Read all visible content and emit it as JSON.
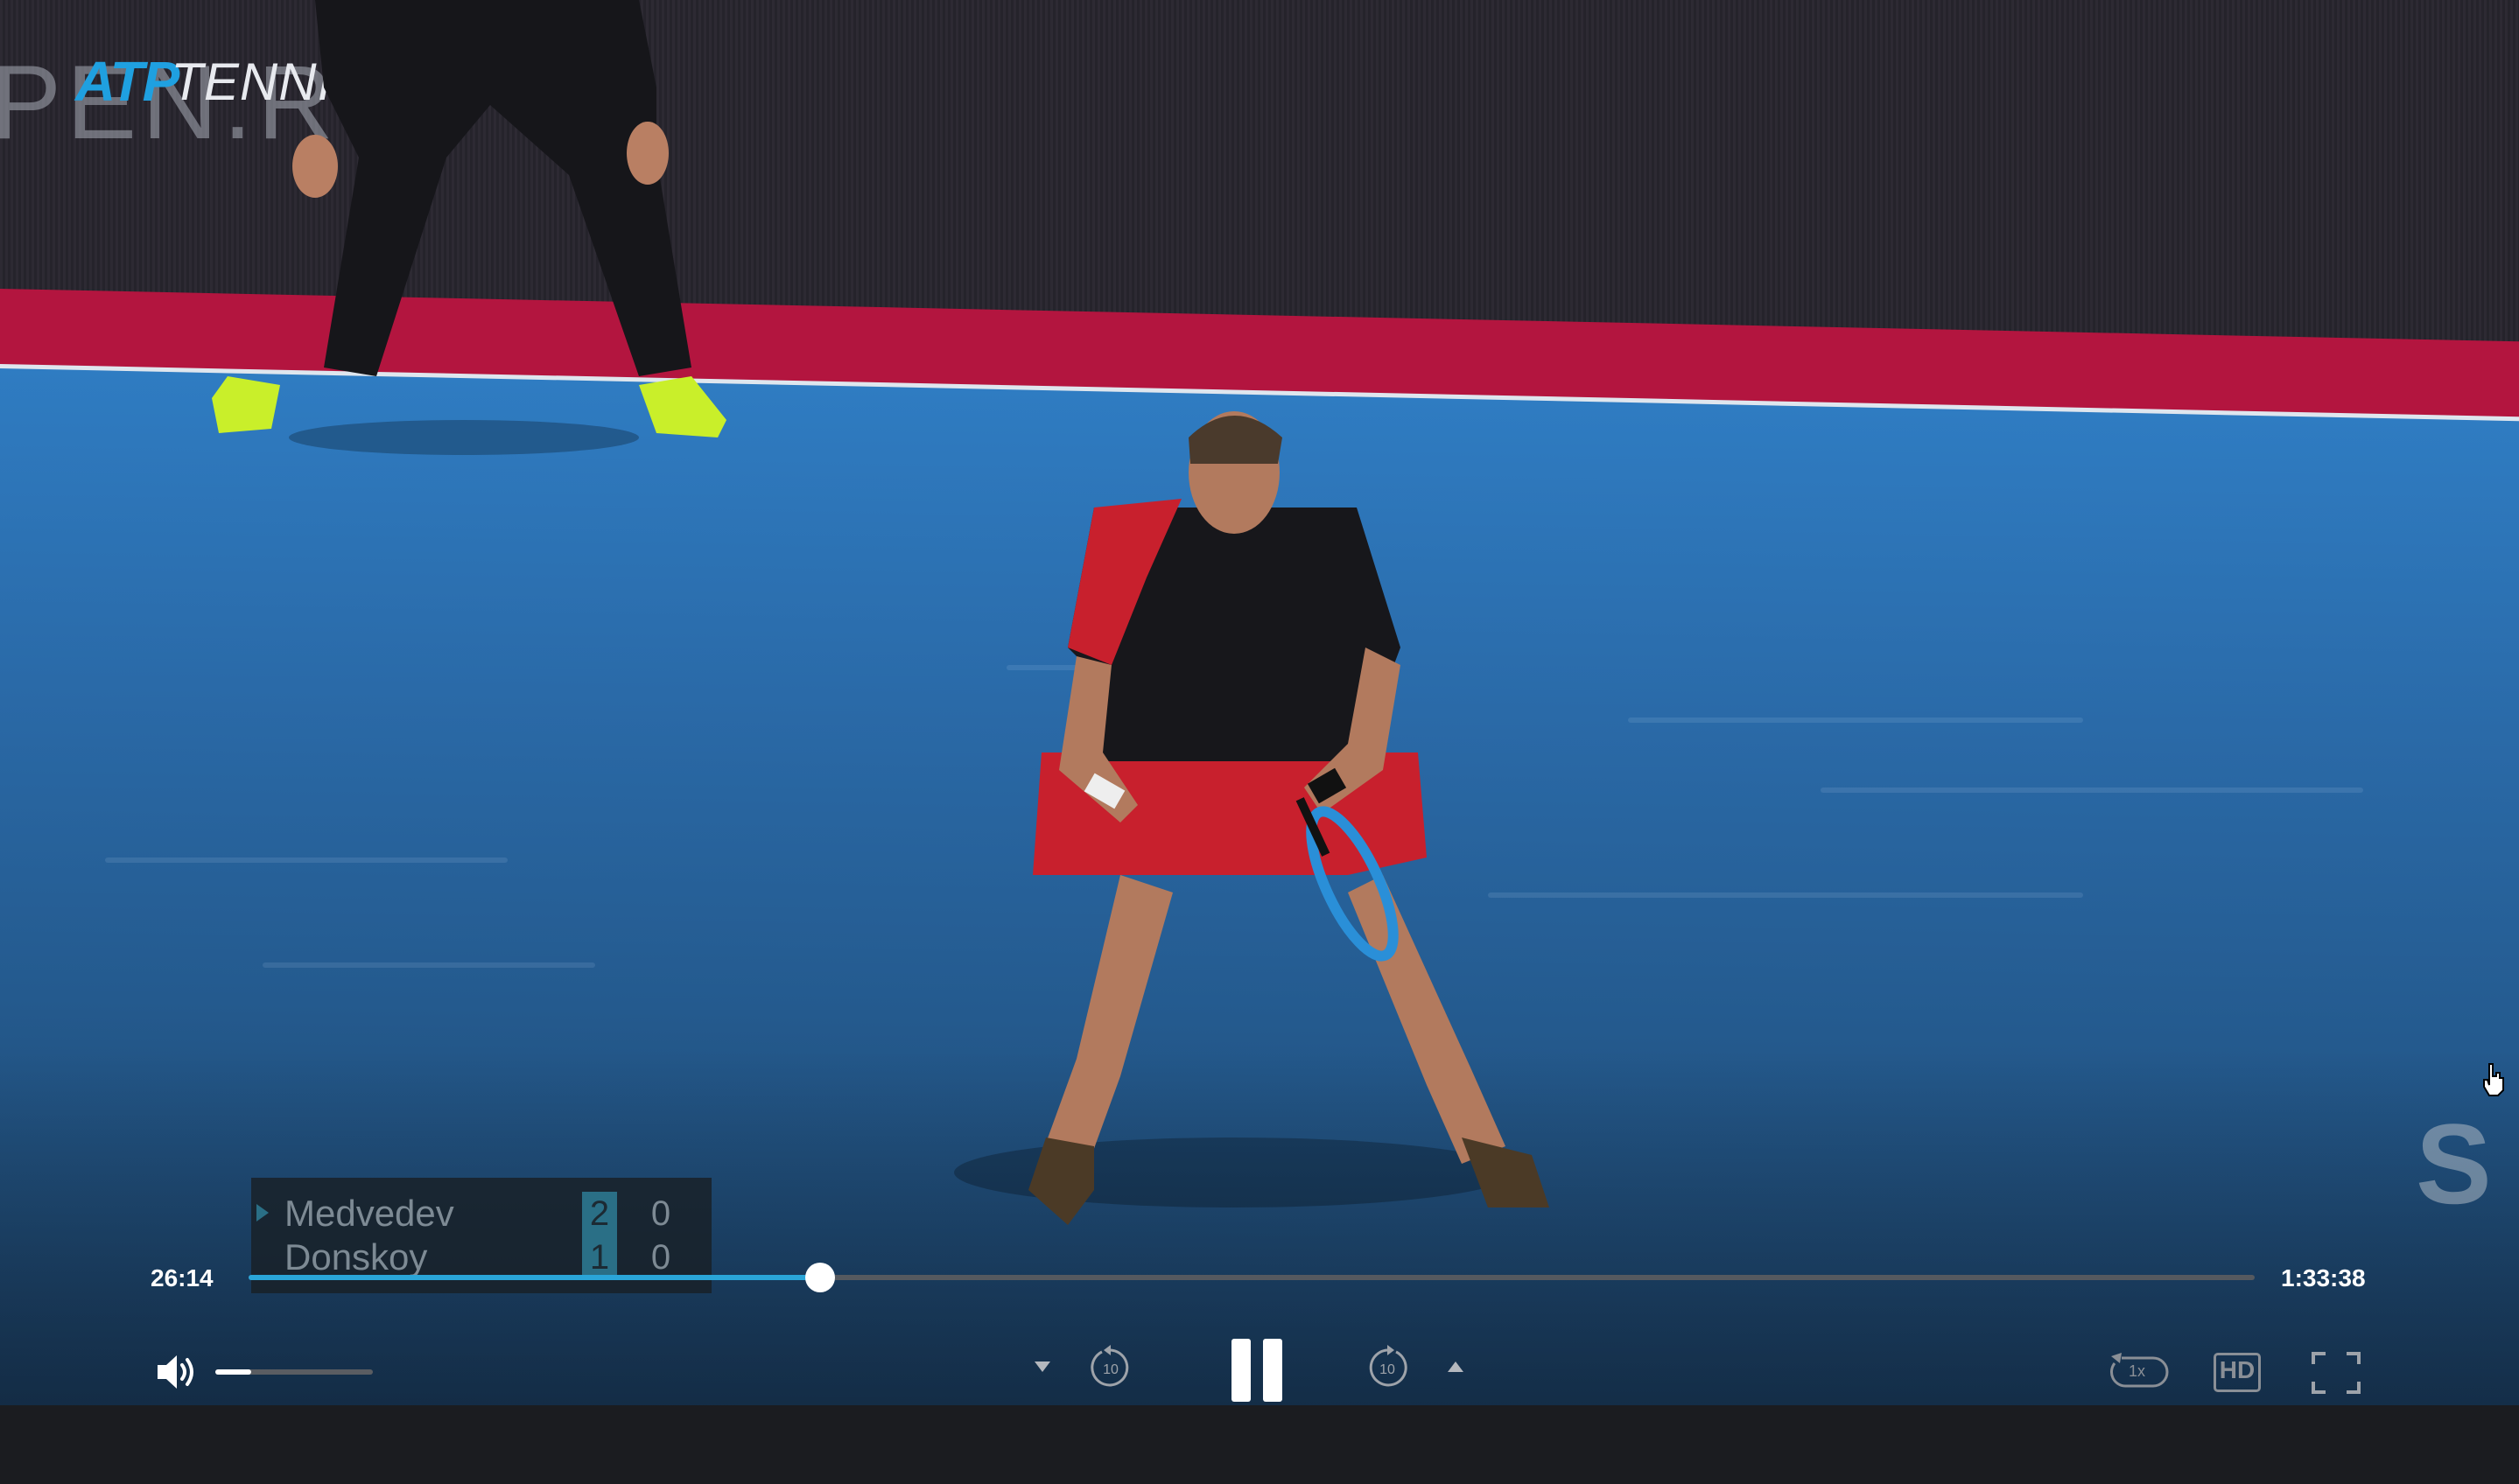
{
  "video": {
    "brand": {
      "atp": "ATP",
      "tv": "TENNIS TV"
    },
    "wall_text": "PEN.RU",
    "wall_letter": "S"
  },
  "scoreboard": {
    "players": [
      {
        "name": "Medvedev",
        "sets": "2",
        "games": "0",
        "serving": true
      },
      {
        "name": "Donskoy",
        "sets": "1",
        "games": "0",
        "serving": false
      }
    ]
  },
  "player_controls": {
    "current_time": "26:14",
    "duration": "1:33:38",
    "progress_fraction": 0.285,
    "volume_fraction": 0.23,
    "rewind_label": "10",
    "forward_label": "10",
    "speed_label": "1x",
    "hd_label": "HD",
    "icons": {
      "volume": "volume-high-icon",
      "rate_down": "caret-down-icon",
      "rewind": "rewind-10-icon",
      "pause": "pause-icon",
      "forward": "forward-10-icon",
      "rate_up": "caret-up-icon",
      "speed": "playback-speed-icon",
      "quality": "hd-icon",
      "fullscreen": "fullscreen-icon"
    }
  },
  "colors": {
    "progress_accent": "#2aa5d8",
    "court_blue": "#2a6aa8",
    "wall_red": "#b3153f",
    "set_highlight": "#2a6f86"
  }
}
